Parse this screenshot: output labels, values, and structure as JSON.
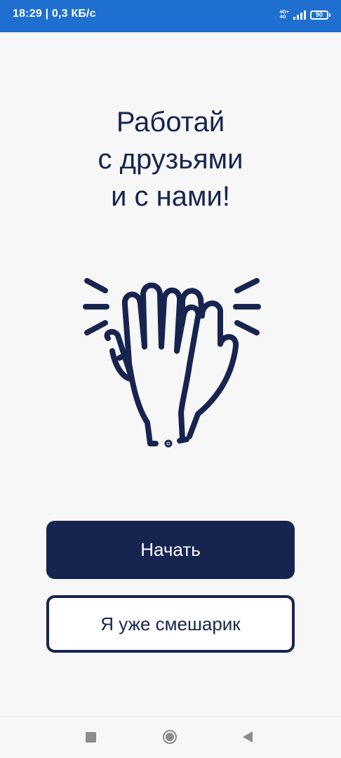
{
  "status_bar": {
    "time_speed": "18:29 | 0,3 КБ/с",
    "network_top": "4G+",
    "network_bottom": "4G",
    "battery": "90",
    "color": "#1f6fd1"
  },
  "onboarding": {
    "title_lines": [
      "Работай",
      "с друзьями",
      "и с нами!"
    ],
    "illustration_icon": "high-five-icon",
    "accent_color": "#17244f",
    "start_button": "Начать",
    "existing_user_button": "Я уже смешарик"
  },
  "nav_bar": {
    "recents_icon": "square-icon",
    "home_icon": "circle-icon",
    "back_icon": "back-triangle-icon"
  }
}
